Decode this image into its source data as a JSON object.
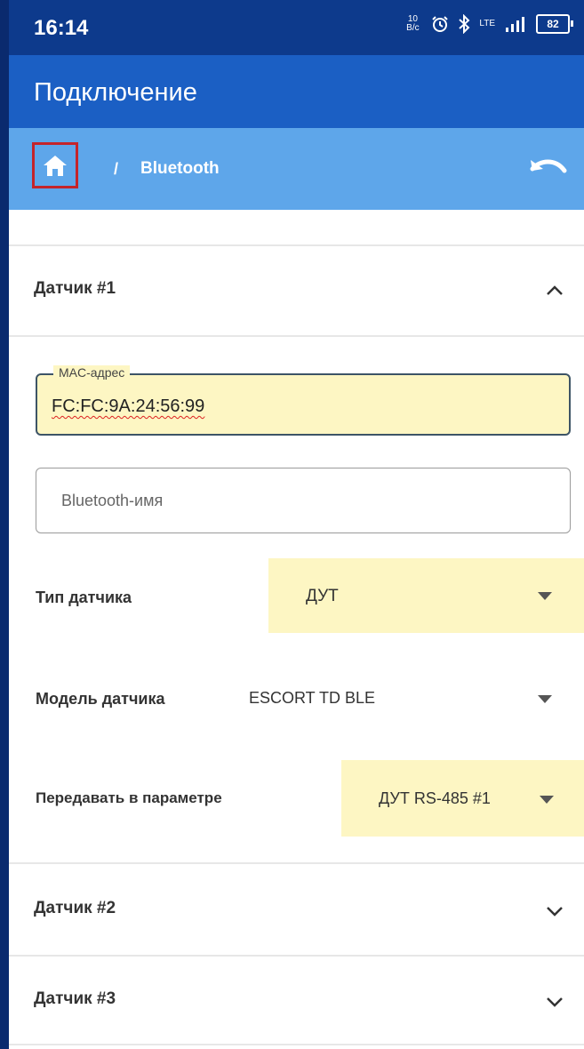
{
  "status_bar": {
    "time": "16:14",
    "speed": "10 B/c",
    "network": "LTE",
    "battery": "82",
    "icons": [
      "alarm-icon",
      "bluetooth-icon",
      "volte-icon",
      "signal-icon",
      "battery-icon"
    ]
  },
  "app_bar": {
    "title": "Подключение"
  },
  "breadcrumb": {
    "separator": "/",
    "current": "Bluetooth",
    "home_icon": "home-icon",
    "back_icon": "undo-icon",
    "highlight_color": "#c4242b"
  },
  "sensor1": {
    "title": "Датчик #1",
    "expanded": true,
    "mac": {
      "label": "MAC-адрес",
      "value": "FC:FC:9A:24:56:99"
    },
    "bt_name": {
      "placeholder": "Bluetooth-имя",
      "value": ""
    },
    "type": {
      "label": "Тип датчика",
      "value": "ДУТ"
    },
    "model": {
      "label": "Модель датчика",
      "value": "ESCORT TD BLE"
    },
    "param": {
      "label": "Передавать в параметре",
      "value": "ДУТ RS-485 #1"
    }
  },
  "sensor2": {
    "title": "Датчик #2",
    "expanded": false
  },
  "sensor3": {
    "title": "Датчик #3",
    "expanded": false
  },
  "colors": {
    "status_bar": "#0d3a8c",
    "app_bar": "#1b5fc4",
    "breadcrumb_bar": "#5ea6ea",
    "highlight": "#fdf6c3"
  }
}
